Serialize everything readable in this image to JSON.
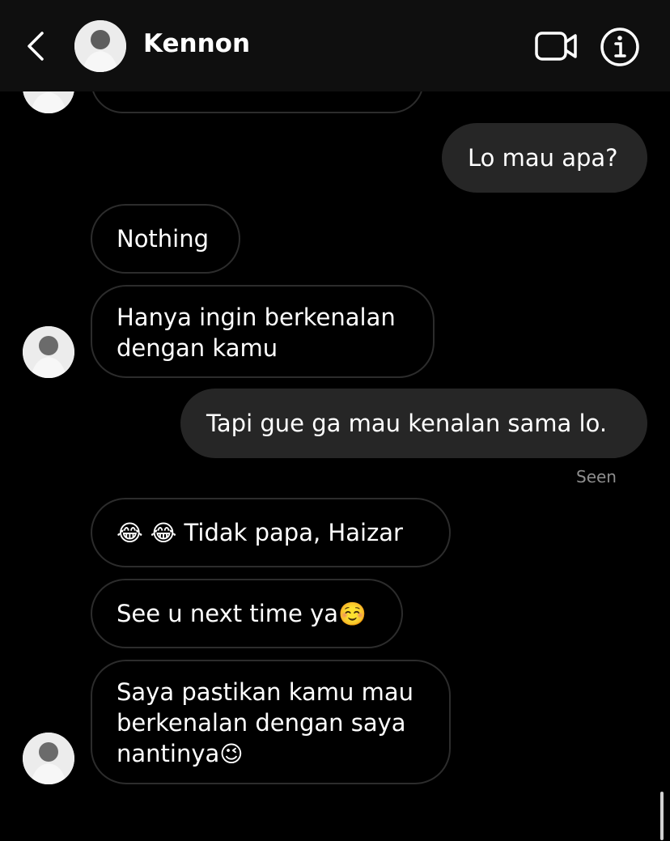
{
  "header": {
    "contact_name": "Kennon"
  },
  "messages": {
    "m1": "Lo mau apa?",
    "m2": "Nothing",
    "m3_line1": "Hanya ingin berkenalan",
    "m3_line2": "dengan kamu",
    "m4": "Tapi gue ga mau kenalan sama lo.",
    "seen": "Seen",
    "m5_emoji": "😂 😂",
    "m5_text": " Tidak papa, Haizar",
    "m6_text": "See u next time ya",
    "m6_emoji": "☺️",
    "m7_line1": "Saya pastikan kamu mau",
    "m7_line2": "berkenalan dengan saya",
    "m7_line3": "nantinya",
    "m7_emoji": "😉"
  },
  "icons": {
    "back": "chevron-left-icon",
    "video": "video-camera-icon",
    "info": "info-icon"
  }
}
